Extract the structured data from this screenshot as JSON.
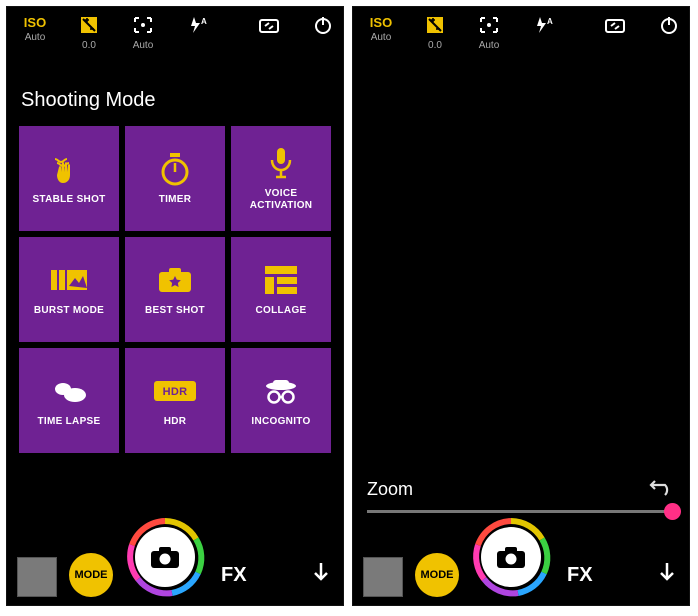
{
  "colors": {
    "accent_yellow": "#f0c200",
    "tile_purple": "#6f2293",
    "slider_pink": "#ff2f86"
  },
  "topbar": {
    "iso": {
      "title": "ISO",
      "value": "Auto"
    },
    "exposure": {
      "value": "0.0",
      "icon": "exposure-compensation-icon"
    },
    "focus": {
      "value": "Auto",
      "icon": "focus-bracket-icon"
    },
    "flash": {
      "icon": "flash-auto-icon"
    },
    "switch": {
      "icon": "camera-switch-icon"
    },
    "power": {
      "icon": "power-icon"
    }
  },
  "shooting": {
    "header": "Shooting Mode",
    "modes": [
      {
        "key": "stable-shot",
        "label": "STABLE SHOT",
        "icon": "hand-waves-icon"
      },
      {
        "key": "timer",
        "label": "TIMER",
        "icon": "stopwatch-icon"
      },
      {
        "key": "voice-activation",
        "label": "VOICE\nACTIVATION",
        "icon": "microphone-icon"
      },
      {
        "key": "burst-mode",
        "label": "BURST MODE",
        "icon": "burst-stack-icon"
      },
      {
        "key": "best-shot",
        "label": "BEST SHOT",
        "icon": "camera-star-icon"
      },
      {
        "key": "collage",
        "label": "COLLAGE",
        "icon": "collage-layout-icon"
      },
      {
        "key": "time-lapse",
        "label": "TIME LAPSE",
        "icon": "clouds-icon"
      },
      {
        "key": "hdr",
        "label": "HDR",
        "icon": "hdr-badge-icon"
      },
      {
        "key": "incognito",
        "label": "INCOGNITO",
        "icon": "incognito-icon"
      }
    ]
  },
  "bottom": {
    "mode_button": "MODE",
    "fx_button": "FX",
    "shutter": "shutter",
    "collapse": "collapse"
  },
  "zoom": {
    "label": "Zoom",
    "undo": "undo",
    "position_percent": 100
  }
}
